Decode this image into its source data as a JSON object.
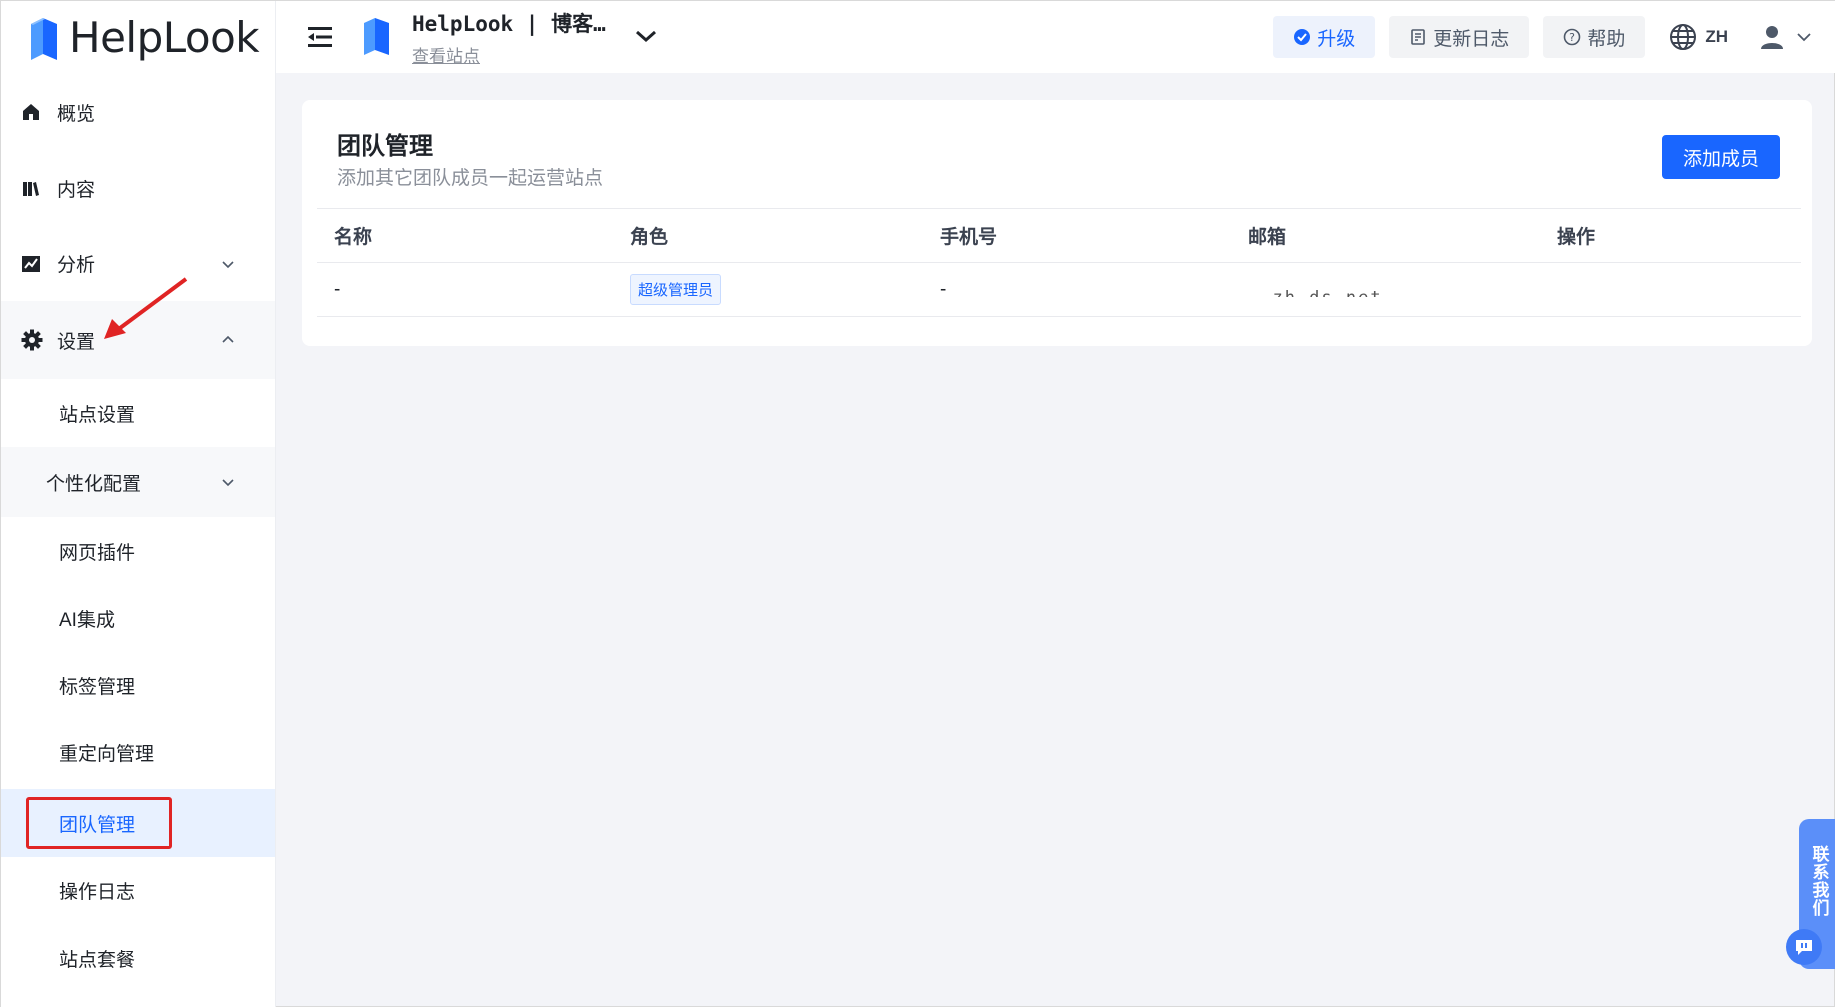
{
  "header": {
    "brand": "HelpLook",
    "site_title": "HelpLook | 博客…",
    "site_link": "查看站点",
    "upgrade": "升级",
    "changelog": "更新日志",
    "help": "帮助",
    "lang": "ZH"
  },
  "sidebar": {
    "items": [
      {
        "label": "概览"
      },
      {
        "label": "内容"
      },
      {
        "label": "分析"
      },
      {
        "label": "设置"
      },
      {
        "label": "站点设置"
      },
      {
        "label": "个性化配置"
      },
      {
        "label": "网页插件"
      },
      {
        "label": "AI集成"
      },
      {
        "label": "标签管理"
      },
      {
        "label": "重定向管理"
      },
      {
        "label": "团队管理"
      },
      {
        "label": "操作日志"
      },
      {
        "label": "站点套餐"
      }
    ]
  },
  "main": {
    "title": "团队管理",
    "subtitle": "添加其它团队成员一起运营站点",
    "add_button": "添加成员",
    "table": {
      "headers": [
        "名称",
        "角色",
        "手机号",
        "邮箱",
        "操作"
      ],
      "rows": [
        {
          "name": "-",
          "role": "超级管理员",
          "phone": "-",
          "email": "ˌ   zh   ds   net"
        }
      ]
    }
  },
  "contact": {
    "label": "联系我们"
  },
  "colors": {
    "accent": "#1966ff",
    "highlight": "#e02424",
    "contact": "#5b8ff9"
  },
  "icons": [
    "helplook-logo",
    "menu-fold-icon",
    "site-logo",
    "chevron-down-icon",
    "check-circle-icon",
    "changelog-icon",
    "help-icon",
    "globe-icon",
    "user-icon",
    "home-icon",
    "book-icon",
    "chart-icon",
    "gear-icon",
    "chevron-up-icon",
    "chat-icon",
    "arrow-annotation"
  ]
}
